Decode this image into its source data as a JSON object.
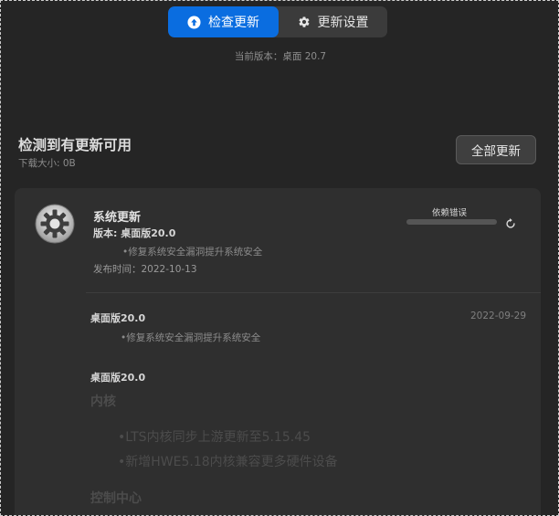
{
  "header": {
    "tabs": [
      {
        "label": "检查更新",
        "icon": "arrow-up-circle-icon",
        "active": true
      },
      {
        "label": "更新设置",
        "icon": "gear-icon",
        "active": false
      }
    ],
    "current_version": "当前版本：桌面 20.7"
  },
  "summary": {
    "title": "检测到有更新可用",
    "download_size": "下载大小: 0B",
    "update_all_label": "全部更新"
  },
  "update_item": {
    "icon": "gear-icon",
    "title": "系统更新",
    "version": "版本: 桌面版20.0",
    "note": "•修复系统安全漏洞提升系统安全",
    "release_date": "发布时间：2022-10-13",
    "status_label": "依赖错误",
    "retry_icon": "retry-icon"
  },
  "changelog": [
    {
      "version": "桌面版20.0",
      "date": "2022-09-29",
      "notes": [
        "•修复系统安全漏洞提升系统安全"
      ]
    },
    {
      "version": "桌面版20.0",
      "sections": [
        {
          "heading": "内核",
          "items": [
            "•LTS内核同步上游更新至5.15.45",
            "•新增HWE5.18内核兼容更多硬件设备"
          ]
        },
        {
          "heading": "控制中心",
          "items": []
        }
      ]
    }
  ],
  "colors": {
    "accent": "#0a6de0",
    "background": "#252525",
    "card": "#2f2f2f"
  }
}
